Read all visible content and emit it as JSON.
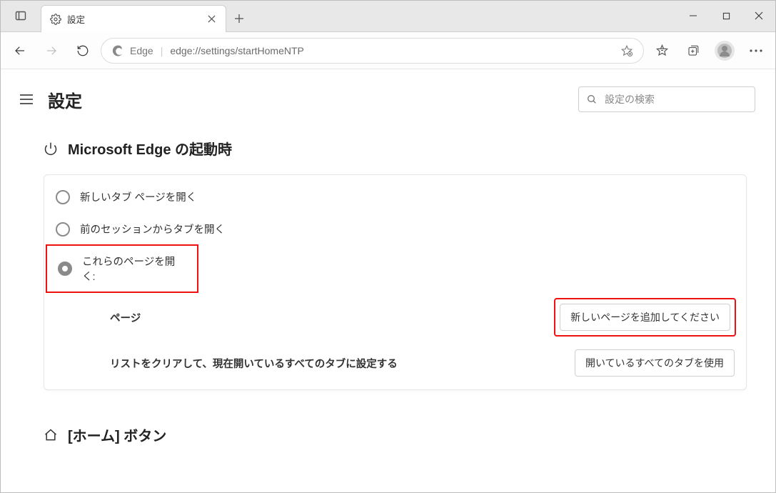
{
  "tab": {
    "title": "設定"
  },
  "omnibox": {
    "identity": "Edge",
    "url": "edge://settings/startHomeNTP"
  },
  "page": {
    "title": "設定",
    "search_placeholder": "設定の検索"
  },
  "startup": {
    "heading": "Microsoft Edge の起動時",
    "options": [
      {
        "label": "新しいタブ ページを開く",
        "selected": false
      },
      {
        "label": "前のセッションからタブを開く",
        "selected": false
      },
      {
        "label": "これらのページを開く:",
        "selected": true
      }
    ],
    "pages_label": "ページ",
    "add_page_btn": "新しいページを追加してください",
    "clear_label": "リストをクリアして、現在開いているすべてのタブに設定する",
    "use_open_tabs_btn": "開いているすべてのタブを使用"
  },
  "home": {
    "heading": "[ホーム] ボタン"
  }
}
